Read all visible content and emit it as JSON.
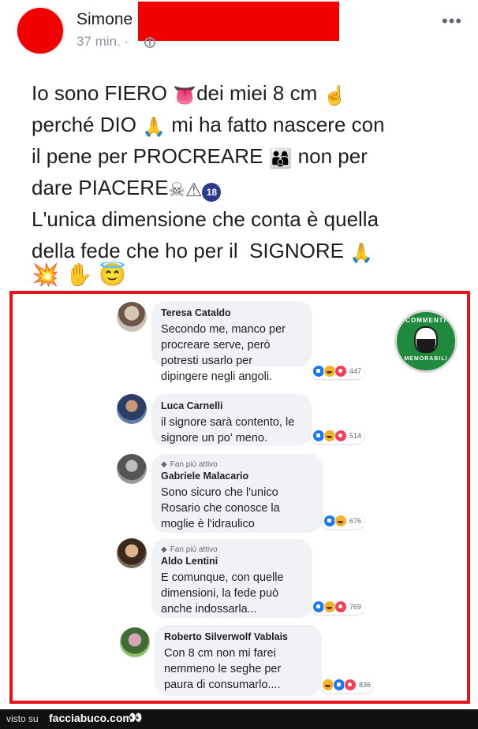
{
  "post": {
    "author": "Simone",
    "time": "37 min. ·",
    "lines": {
      "l1a": "Io sono FIERO ",
      "l1b": "dei miei 8 cm ",
      "l2a": "perché DIO ",
      "l2b": " mi ha fatto nascere con",
      "l3a": "il pene per PROCREARE ",
      "l3b": " non per",
      "l4a": "dare PIACERE",
      "l5": "L'unica dimensione che conta è quella",
      "l6": "della fede che ho per il  SIGNORE "
    },
    "emoji": {
      "tongue": "👅",
      "point_up": "☝",
      "pray": "🙏",
      "family": "👨‍👩‍👦",
      "skull": "☠",
      "warning": "⚠",
      "no18": "18",
      "pray2": "🙏",
      "boom": "💥",
      "hand": "✋",
      "halo": "😇"
    }
  },
  "comments": [
    {
      "badge": "",
      "name": "Teresa Cataldo",
      "text": "Secondo me, manco per\nprocreare serve, però\npotresti usarlo per\ndipingere negli angoli.",
      "reactions": [
        "like",
        "haha",
        "love"
      ],
      "count": "447"
    },
    {
      "badge": "",
      "name": "Luca Carnelli",
      "text": "il signore sarà contento, le\nsignore un po' meno.",
      "reactions": [
        "like",
        "haha",
        "love"
      ],
      "count": "514"
    },
    {
      "badge": "Fan più attivo",
      "name": "Gabriele Malacario",
      "text": "Sono sicuro che l'unico\nRosario che conosce la\nmoglie è l'idraulico",
      "reactions": [
        "like",
        "haha"
      ],
      "count": "676"
    },
    {
      "badge": "Fan più attivo",
      "name": "Aldo Lentini",
      "text": "E comunque, con quelle\ndimensioni, la fede può\nanche indossarla...",
      "reactions": [
        "like",
        "haha",
        "love"
      ],
      "count": "769"
    },
    {
      "badge": "",
      "name": "Roberto Silverwolf Vablais",
      "text": "Con 8 cm non mi farei\nnemmeno le seghe per\npaura di consumarlo....",
      "reactions": [
        "haha",
        "like",
        "love"
      ],
      "count": "836"
    }
  ],
  "logo": {
    "top": "COMMENTI",
    "bottom": "MEMORABILI"
  },
  "footer": {
    "visto": "visto su",
    "site": "facciabuco.com",
    "eyes": "👀"
  },
  "colors": {
    "frame": "#e8141c",
    "redaction": "#f20000",
    "logo_bg": "#1f8a3d"
  }
}
